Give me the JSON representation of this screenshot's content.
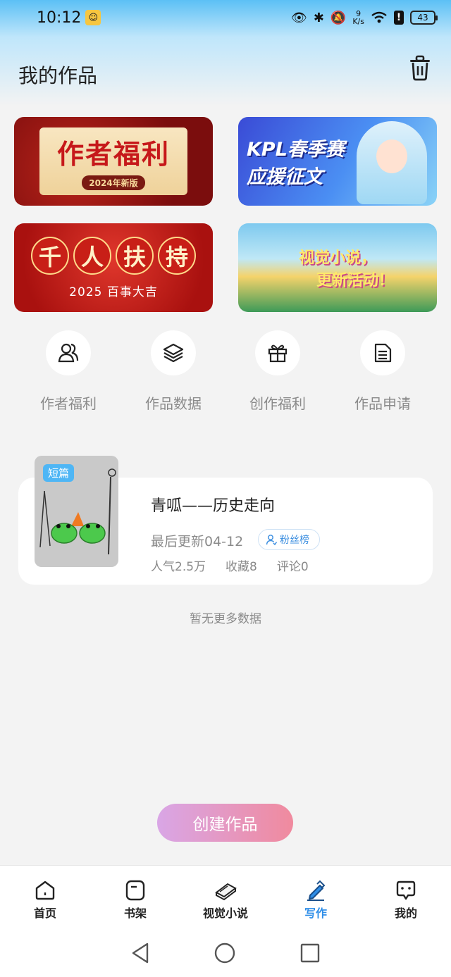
{
  "status_bar": {
    "time": "10:12",
    "net_speed_value": "9",
    "net_speed_unit": "K/s",
    "battery": "43"
  },
  "header": {
    "title": "我的作品"
  },
  "banners": [
    {
      "line1": "作者福利",
      "line2": "2024年新版"
    },
    {
      "line1": "KPL春季赛",
      "line2": "应援征文"
    },
    {
      "chars": [
        "千",
        "人",
        "扶",
        "持"
      ],
      "line2": "2025 百事大吉"
    },
    {
      "line1": "视觉小说，",
      "line2": "更新活动！"
    }
  ],
  "quick_actions": [
    {
      "label": "作者福利",
      "icon": "users-icon"
    },
    {
      "label": "作品数据",
      "icon": "layers-icon"
    },
    {
      "label": "创作福利",
      "icon": "gift-icon"
    },
    {
      "label": "作品申请",
      "icon": "document-icon"
    }
  ],
  "work": {
    "tag": "短篇",
    "title": "青呱——历史走向",
    "updated": "最后更新04-12",
    "fans_label": "粉丝榜",
    "popularity": "人气2.5万",
    "favorites": "收藏8",
    "comments": "评论0"
  },
  "list_footer": "暂无更多数据",
  "create_button": "创建作品",
  "tabs": [
    {
      "label": "首页",
      "icon": "home-icon"
    },
    {
      "label": "书架",
      "icon": "bookshelf-icon"
    },
    {
      "label": "视觉小说",
      "icon": "visual-novel-icon"
    },
    {
      "label": "写作",
      "icon": "write-icon",
      "active": true
    },
    {
      "label": "我的",
      "icon": "profile-icon"
    }
  ],
  "colors": {
    "accent": "#2f8ee8",
    "create_gradient_start": "#d9a6e6",
    "create_gradient_end": "#f08a9e",
    "tag_blue": "#4fb6f5"
  }
}
